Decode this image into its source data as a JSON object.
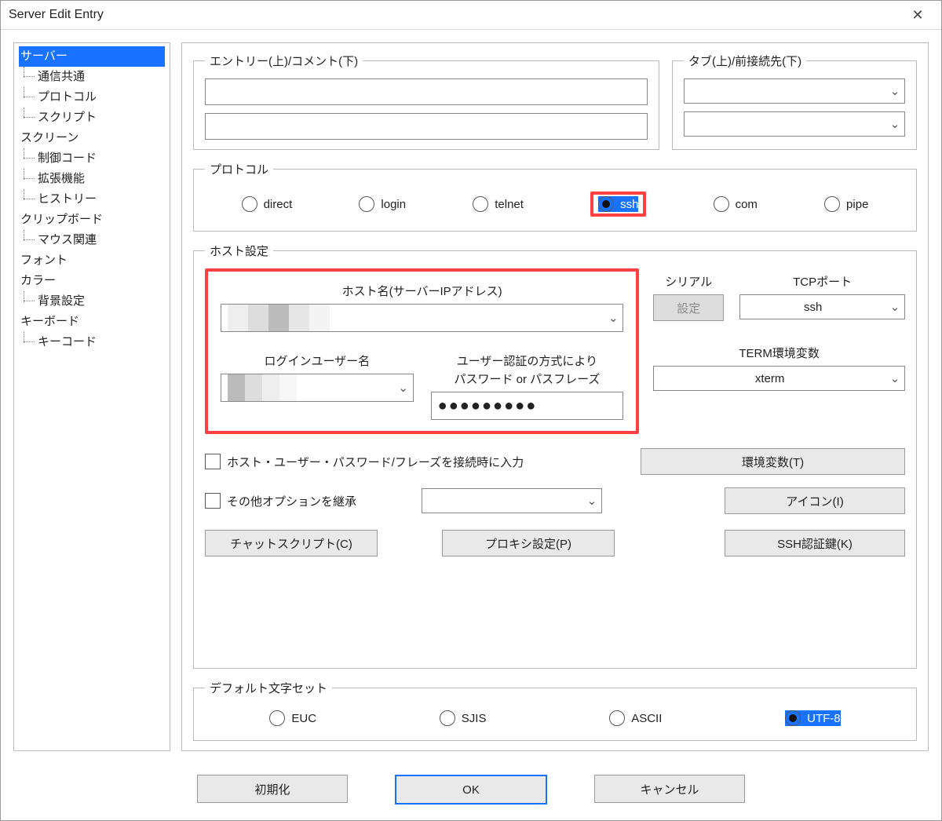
{
  "window": {
    "title": "Server Edit Entry",
    "close": "✕"
  },
  "sidebar": {
    "items": [
      {
        "label": "サーバー",
        "sel": true,
        "indent": 0
      },
      {
        "label": "通信共通",
        "indent": 1
      },
      {
        "label": "プロトコル",
        "indent": 1
      },
      {
        "label": "スクリプト",
        "indent": 1
      },
      {
        "label": "スクリーン",
        "indent": 0
      },
      {
        "label": "制御コード",
        "indent": 1
      },
      {
        "label": "拡張機能",
        "indent": 1
      },
      {
        "label": "ヒストリー",
        "indent": 1
      },
      {
        "label": "クリップボード",
        "indent": 0
      },
      {
        "label": "マウス関連",
        "indent": 1
      },
      {
        "label": "フォント",
        "indent": 0
      },
      {
        "label": "カラー",
        "indent": 0
      },
      {
        "label": "背景設定",
        "indent": 1
      },
      {
        "label": "キーボード",
        "indent": 0
      },
      {
        "label": "キーコード",
        "indent": 1
      }
    ]
  },
  "groups": {
    "entry": "エントリー(上)/コメント(下)",
    "tab": "タブ(上)/前接続先(下)",
    "protocol": "プロトコル",
    "host": "ホスト設定",
    "charset": "デフォルト文字セット"
  },
  "protocol": {
    "options": [
      "direct",
      "login",
      "telnet",
      "ssh",
      "com",
      "pipe"
    ],
    "selected": "ssh"
  },
  "host": {
    "hostname_label": "ホスト名(サーバーIPアドレス)",
    "hostname_value": "",
    "serial_label": "シリアル",
    "serial_button": "設定",
    "tcp_port_label": "TCPポート",
    "tcp_port_value": "ssh",
    "login_label": "ログインユーザー名",
    "login_value": "",
    "pass_label_l1": "ユーザー認証の方式により",
    "pass_label_l2": "パスワード or パスフレーズ",
    "pass_value": "●●●●●●●●●",
    "term_label": "TERM環境変数",
    "term_value": "xterm",
    "chk_prompt": "ホスト・ユーザー・パスワード/フレーズを接続時に入力",
    "chk_inherit": "その他オプションを継承",
    "btn_env": "環境変数(T)",
    "btn_icon": "アイコン(I)",
    "btn_chat": "チャットスクリプト(C)",
    "btn_proxy": "プロキシ設定(P)",
    "btn_sshkey": "SSH認証鍵(K)"
  },
  "charset": {
    "options": [
      "EUC",
      "SJIS",
      "ASCII",
      "UTF-8"
    ],
    "selected": "UTF-8"
  },
  "footer": {
    "init": "初期化",
    "ok": "OK",
    "cancel": "キャンセル"
  }
}
